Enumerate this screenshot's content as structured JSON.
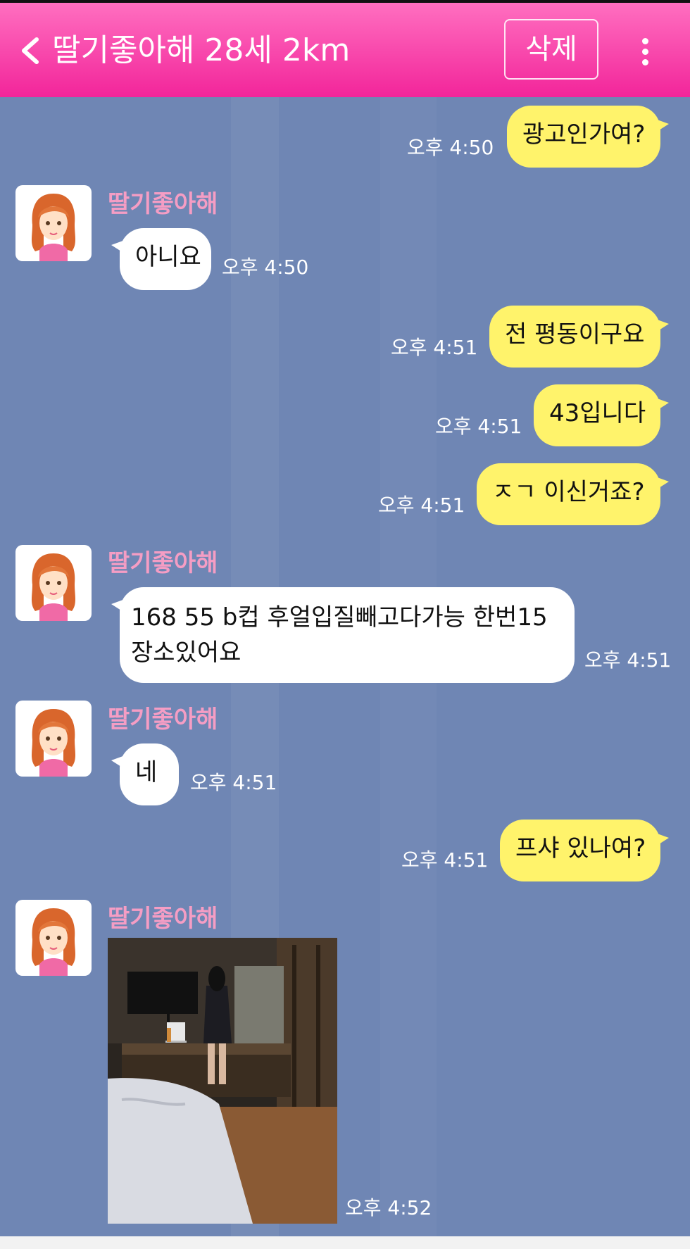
{
  "header": {
    "title": "딸기좋아해 28세 2km",
    "delete_label": "삭제"
  },
  "contact": {
    "name": "딸기좋아해"
  },
  "messages": [
    {
      "side": "me",
      "text": "광고인가여?",
      "time": "오후 4:50"
    },
    {
      "side": "them",
      "text": "아니요",
      "time": "오후 4:50"
    },
    {
      "side": "me",
      "text": "전 평동이구요",
      "time": "오후 4:51"
    },
    {
      "side": "me",
      "text": "43입니다",
      "time": "오후 4:51"
    },
    {
      "side": "me",
      "text": "ㅈㄱ 이신거죠?",
      "time": "오후 4:51"
    },
    {
      "side": "them",
      "line1": "168 55 b컵 후얼입질빼고다가능 한번15",
      "line2": "장소있어요",
      "time": "오후 4:51"
    },
    {
      "side": "them",
      "text": "네",
      "time": "오후 4:51"
    },
    {
      "side": "me",
      "text": "프샤 있나여?",
      "time": "오후 4:51"
    },
    {
      "side": "them",
      "type": "photo",
      "time": "오후 4:52"
    }
  ],
  "colors": {
    "header_gradient_top": "#ff6fc0",
    "header_gradient_bottom": "#f2259a",
    "chat_background": "#6f86b4",
    "my_bubble": "#fff36b",
    "their_bubble": "#ffffff",
    "sender_name": "#f59dc4"
  },
  "icons": [
    "back-chevron-icon",
    "more-vertical-icon",
    "avatar-girl-icon"
  ]
}
